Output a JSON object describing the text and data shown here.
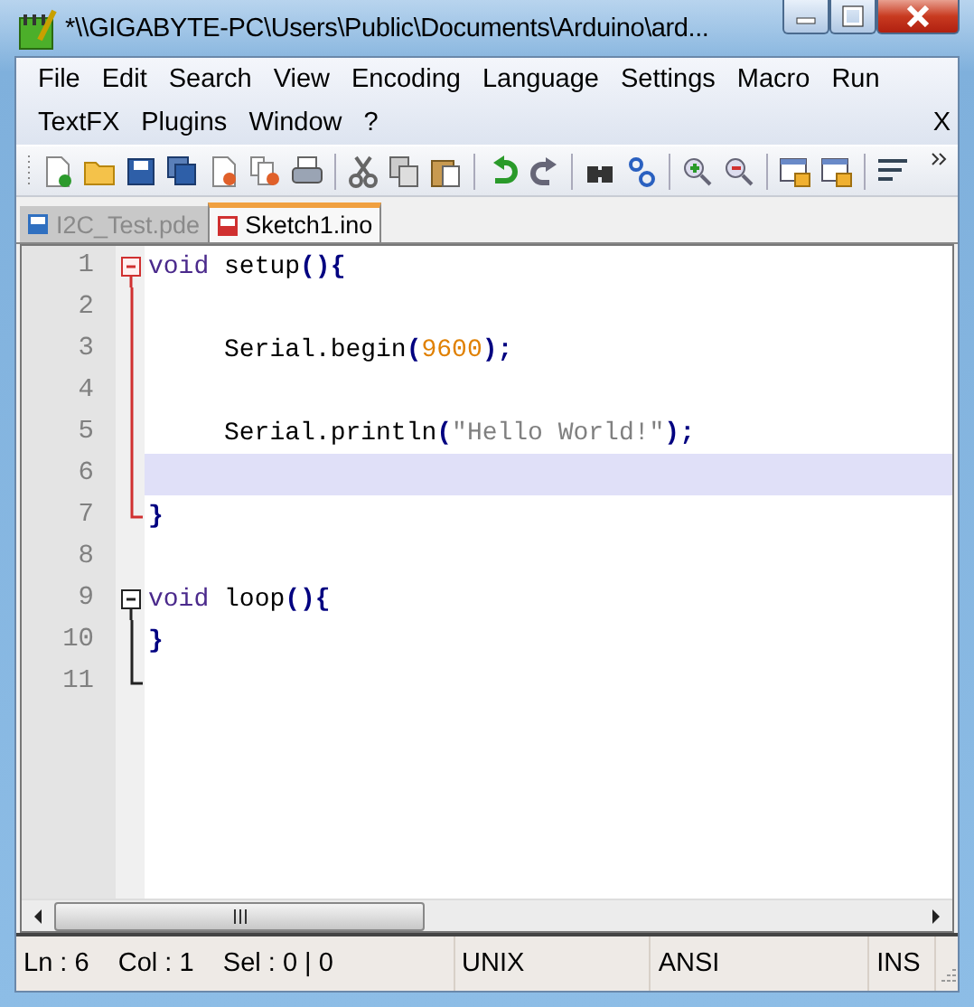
{
  "window": {
    "title": "*\\\\GIGABYTE-PC\\Users\\Public\\Documents\\Arduino\\ard..."
  },
  "menu_bar": {
    "items": [
      {
        "label": "File"
      },
      {
        "label": "Edit"
      },
      {
        "label": "Search"
      },
      {
        "label": "View"
      },
      {
        "label": "Encoding"
      },
      {
        "label": "Language"
      },
      {
        "label": "Settings"
      },
      {
        "label": "Macro"
      },
      {
        "label": "Run"
      },
      {
        "label": "TextFX"
      },
      {
        "label": "Plugins"
      },
      {
        "label": "Window"
      },
      {
        "label": "?"
      }
    ],
    "close_label": "X"
  },
  "tabs": [
    {
      "label": "I2C_Test.pde",
      "selected": false
    },
    {
      "label": "Sketch1.ino",
      "selected": true
    }
  ],
  "editor": {
    "lines": [
      {
        "number": "1",
        "fold": {
          "kind": "open",
          "active": true
        },
        "current": false,
        "tokens": [
          {
            "kind": "keyword",
            "text": "void"
          },
          {
            "kind": "plain",
            "text": " setup"
          },
          {
            "kind": "operator",
            "text": "(){"
          }
        ]
      },
      {
        "number": "2",
        "fold": {
          "kind": "line",
          "active": true
        },
        "current": false
      },
      {
        "number": "3",
        "fold": {
          "kind": "line",
          "active": true
        },
        "current": false,
        "tokens": [
          {
            "kind": "plain",
            "text": "     Serial.begin"
          },
          {
            "kind": "operator",
            "text": "("
          },
          {
            "kind": "number",
            "text": "9600"
          },
          {
            "kind": "operator",
            "text": ");"
          }
        ]
      },
      {
        "number": "4",
        "fold": {
          "kind": "line",
          "active": true
        },
        "current": false
      },
      {
        "number": "5",
        "fold": {
          "kind": "line",
          "active": true
        },
        "current": false,
        "tokens": [
          {
            "kind": "plain",
            "text": "     Serial.println"
          },
          {
            "kind": "operator",
            "text": "("
          },
          {
            "kind": "string",
            "text": "\"Hello World!\""
          },
          {
            "kind": "operator",
            "text": ");"
          }
        ]
      },
      {
        "number": "6",
        "fold": {
          "kind": "line",
          "active": true
        },
        "current": true
      },
      {
        "number": "7",
        "fold": {
          "kind": "end",
          "active": true
        },
        "current": false,
        "tokens": [
          {
            "kind": "operator",
            "text": "}"
          }
        ]
      },
      {
        "number": "8",
        "current": false
      },
      {
        "number": "9",
        "fold": {
          "kind": "open",
          "active": false
        },
        "current": false,
        "tokens": [
          {
            "kind": "keyword",
            "text": "void"
          },
          {
            "kind": "plain",
            "text": " loop"
          },
          {
            "kind": "operator",
            "text": "(){"
          }
        ]
      },
      {
        "number": "10",
        "fold": {
          "kind": "line",
          "active": false
        },
        "current": false,
        "tokens": [
          {
            "kind": "operator",
            "text": "}"
          }
        ]
      },
      {
        "number": "11",
        "fold": {
          "kind": "end",
          "active": false
        },
        "current": false
      }
    ]
  },
  "status_bar": {
    "position": "Ln : 6    Col : 1    Sel : 0 | 0",
    "eol": "UNIX",
    "encoding": "ANSI",
    "mode": "INS"
  }
}
